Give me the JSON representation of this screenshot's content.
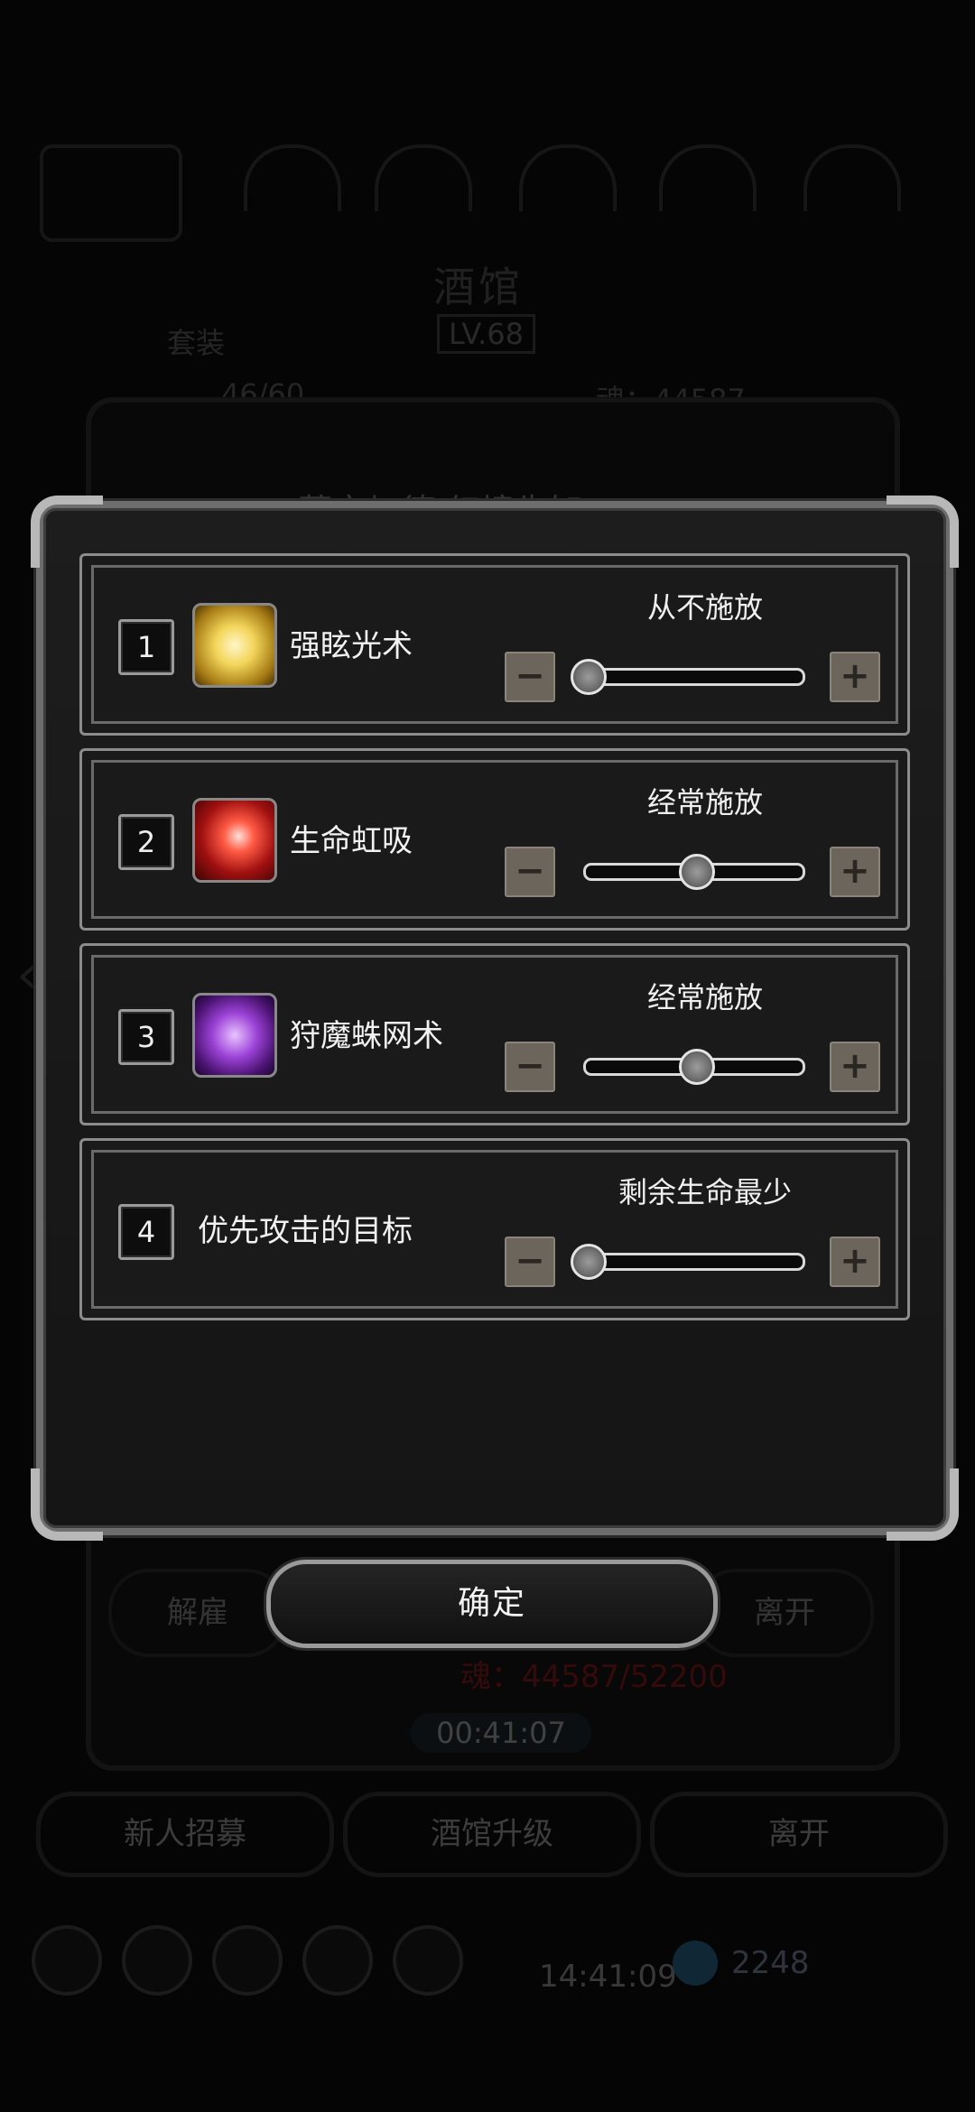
{
  "background": {
    "title": "酒馆",
    "level": "LV.68",
    "tab_label": "套装",
    "count_text": "46/60",
    "soul_text": "魂：44587",
    "subtitle": "莫文加德 幻境先知",
    "left_button": "解雇",
    "right_button": "离开",
    "souls_text": "魂：44587/52200",
    "timer": "00:41:07",
    "bottom_buttons": [
      "新人招募",
      "酒馆升级",
      "离开"
    ],
    "clock": "14:41:09",
    "gem_count": "2248"
  },
  "dialog": {
    "rows": [
      {
        "number": "1",
        "name": "强眩光术",
        "icon": "stun-light-skill-icon",
        "status": "从不施放",
        "level": 0
      },
      {
        "number": "2",
        "name": "生命虹吸",
        "icon": "life-drain-skill-icon",
        "status": "经常施放",
        "level": 0.5
      },
      {
        "number": "3",
        "name": "狩魔蛛网术",
        "icon": "spider-web-skill-icon",
        "status": "经常施放",
        "level": 0.5
      },
      {
        "number": "4",
        "name": "优先攻击的目标",
        "icon": null,
        "status": "剩余生命最少",
        "level": 0
      }
    ],
    "minus_symbol": "−",
    "plus_symbol": "+",
    "confirm_label": "确定"
  }
}
